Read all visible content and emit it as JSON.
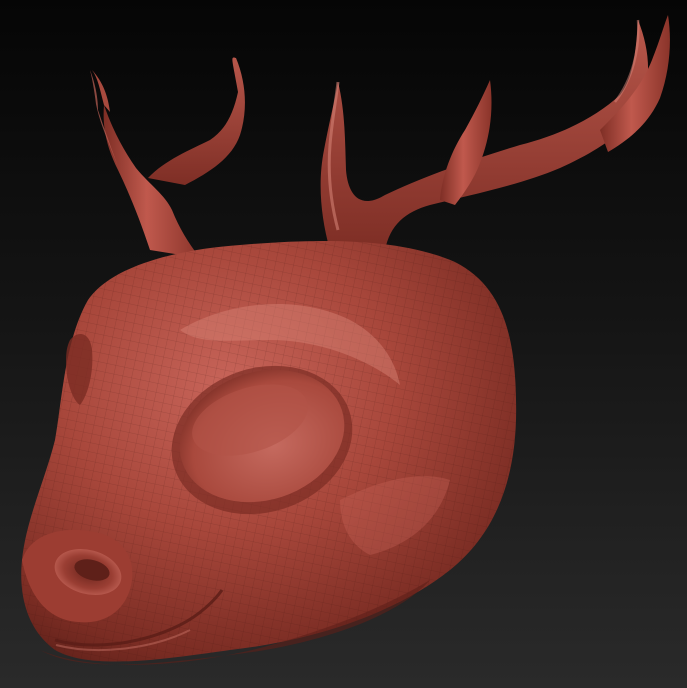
{
  "viewport": {
    "background_top": "#050505",
    "background_bottom": "#2a2a2a"
  },
  "model": {
    "material_color": "#a8473b",
    "shadow_color": "#5e2019",
    "highlight_color": "#d77a6e"
  }
}
